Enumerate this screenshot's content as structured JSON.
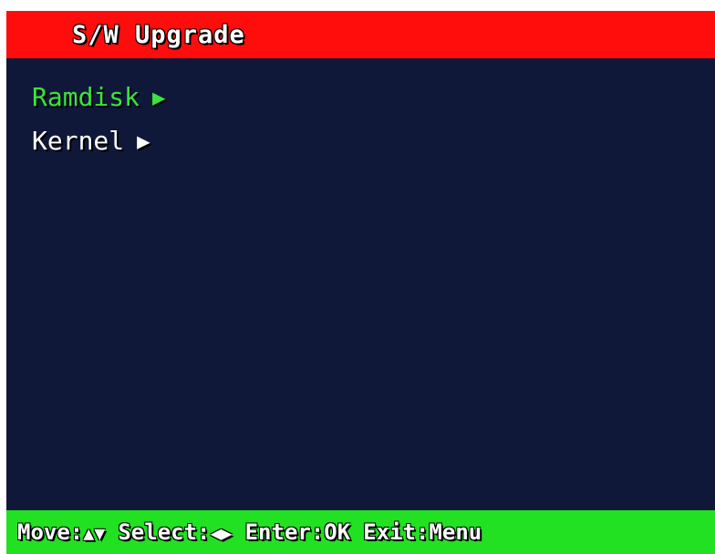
{
  "header": {
    "title": "S/W Upgrade"
  },
  "menu": {
    "items": [
      {
        "label": "Ramdisk",
        "arrow": "▶",
        "selected": true
      },
      {
        "label": "Kernel",
        "arrow": "▶",
        "selected": false
      }
    ]
  },
  "footer": {
    "move_label": "Move:",
    "move_icons": "▲▼",
    "select_label": "Select:",
    "select_icons": "◀▶",
    "enter_label": "Enter:OK",
    "exit_label": "Exit:Menu"
  },
  "colors": {
    "title_bar": "#ff0d0d",
    "menu_background": "#10183a",
    "status_bar": "#22e022",
    "selected_text": "#3ce43c",
    "text": "#ffffff"
  }
}
